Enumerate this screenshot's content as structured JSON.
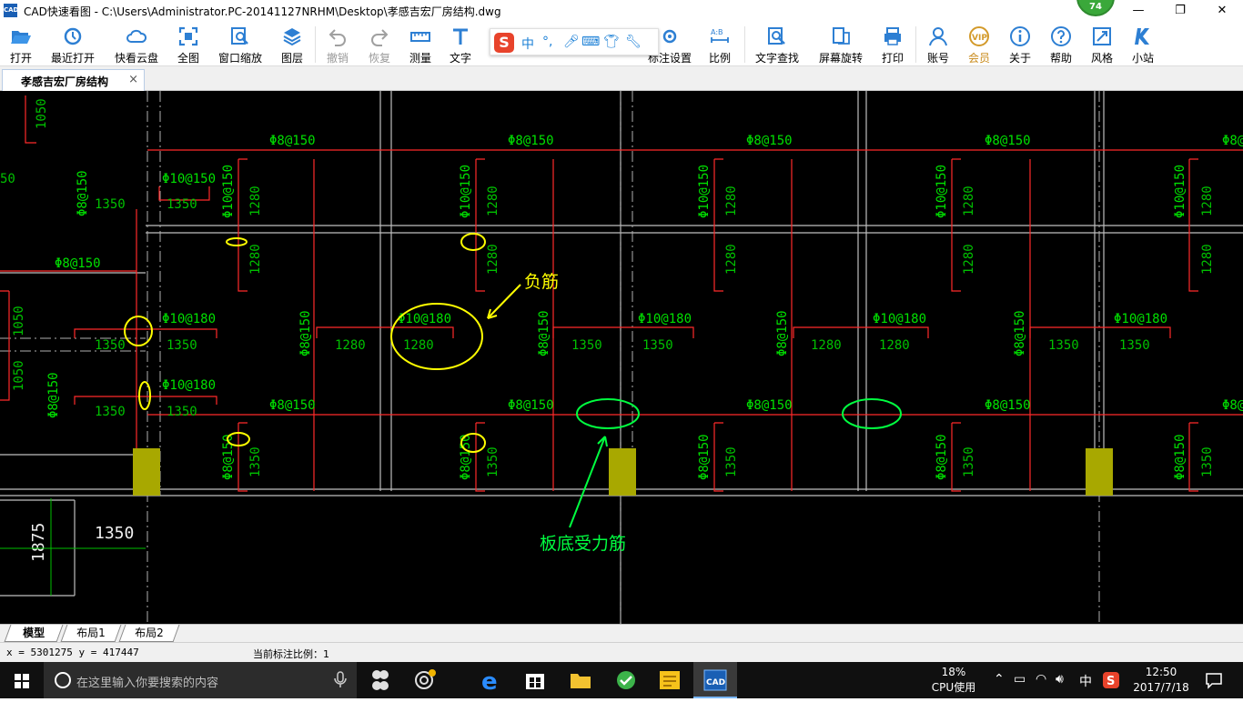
{
  "window": {
    "title": "CAD快速看图 - C:\\Users\\Administrator.PC-20141127NRHM\\Desktop\\孝感吉宏厂房结构.dwg",
    "badge": "74",
    "icon_label": "CAD"
  },
  "toolbar": {
    "items": [
      {
        "label": "打开",
        "icon": "folder-open-icon"
      },
      {
        "label": "最近打开",
        "icon": "history-icon"
      },
      {
        "label": "快看云盘",
        "icon": "cloud-icon"
      },
      {
        "label": "全图",
        "icon": "fit-all-icon"
      },
      {
        "label": "窗口缩放",
        "icon": "zoom-window-icon"
      },
      {
        "label": "图层",
        "icon": "layers-icon"
      },
      {
        "label": "撤销",
        "icon": "undo-icon"
      },
      {
        "label": "恢复",
        "icon": "redo-icon"
      },
      {
        "label": "测量",
        "icon": "ruler-icon"
      },
      {
        "label": "文字",
        "icon": "text-icon"
      },
      {
        "label": "标注设置",
        "icon": "dimension-settings-icon"
      },
      {
        "label": "比例",
        "icon": "scale-icon"
      },
      {
        "label": "文字查找",
        "icon": "text-search-icon"
      },
      {
        "label": "屏幕旋转",
        "icon": "rotate-screen-icon"
      },
      {
        "label": "打印",
        "icon": "print-icon"
      },
      {
        "label": "账号",
        "icon": "account-icon"
      },
      {
        "label": "会员",
        "icon": "vip-icon"
      },
      {
        "label": "关于",
        "icon": "info-icon"
      },
      {
        "label": "帮助",
        "icon": "help-icon"
      },
      {
        "label": "风格",
        "icon": "style-icon"
      },
      {
        "label": "小站",
        "icon": "k-station-icon"
      }
    ]
  },
  "ime": {
    "logo": "S",
    "mode": "中",
    "punct": "°,"
  },
  "document_tab": {
    "label": "孝感吉宏厂房结构",
    "close": "×"
  },
  "drawing": {
    "rebar_top": [
      "Φ8@150",
      "Φ8@150",
      "Φ8@150",
      "Φ8@150",
      "Φ8@150",
      "Φ8@"
    ],
    "rebar_mid": [
      "Φ8@150",
      "Φ8@150",
      "Φ8@150",
      "Φ8@150",
      "Φ8@150",
      "Φ8@"
    ],
    "phi10_150": "Φ10@150",
    "phi10_180": "Φ10@180",
    "phi8_150": "Φ8@150",
    "phi8_150_left": "Φ8@150",
    "dim_1350": "1350",
    "dim_1280": "1280",
    "dim_1050": "1050",
    "dim_1875": "1875",
    "edge_50": "50",
    "annotation_negative_rebar": "负筋",
    "annotation_bottom_rebar": "板底受力筋"
  },
  "layout_tabs": [
    "模型",
    "布局1",
    "布局2"
  ],
  "status": {
    "coords": "x = 5301275  y = 417447",
    "scale": "当前标注比例：1"
  },
  "taskbar": {
    "search_placeholder": "在这里输入你要搜索的内容",
    "cpu_percent": "18%",
    "cpu_label": "CPU使用",
    "ime_indicator": "中",
    "time": "12:50",
    "date": "2017/7/18"
  }
}
